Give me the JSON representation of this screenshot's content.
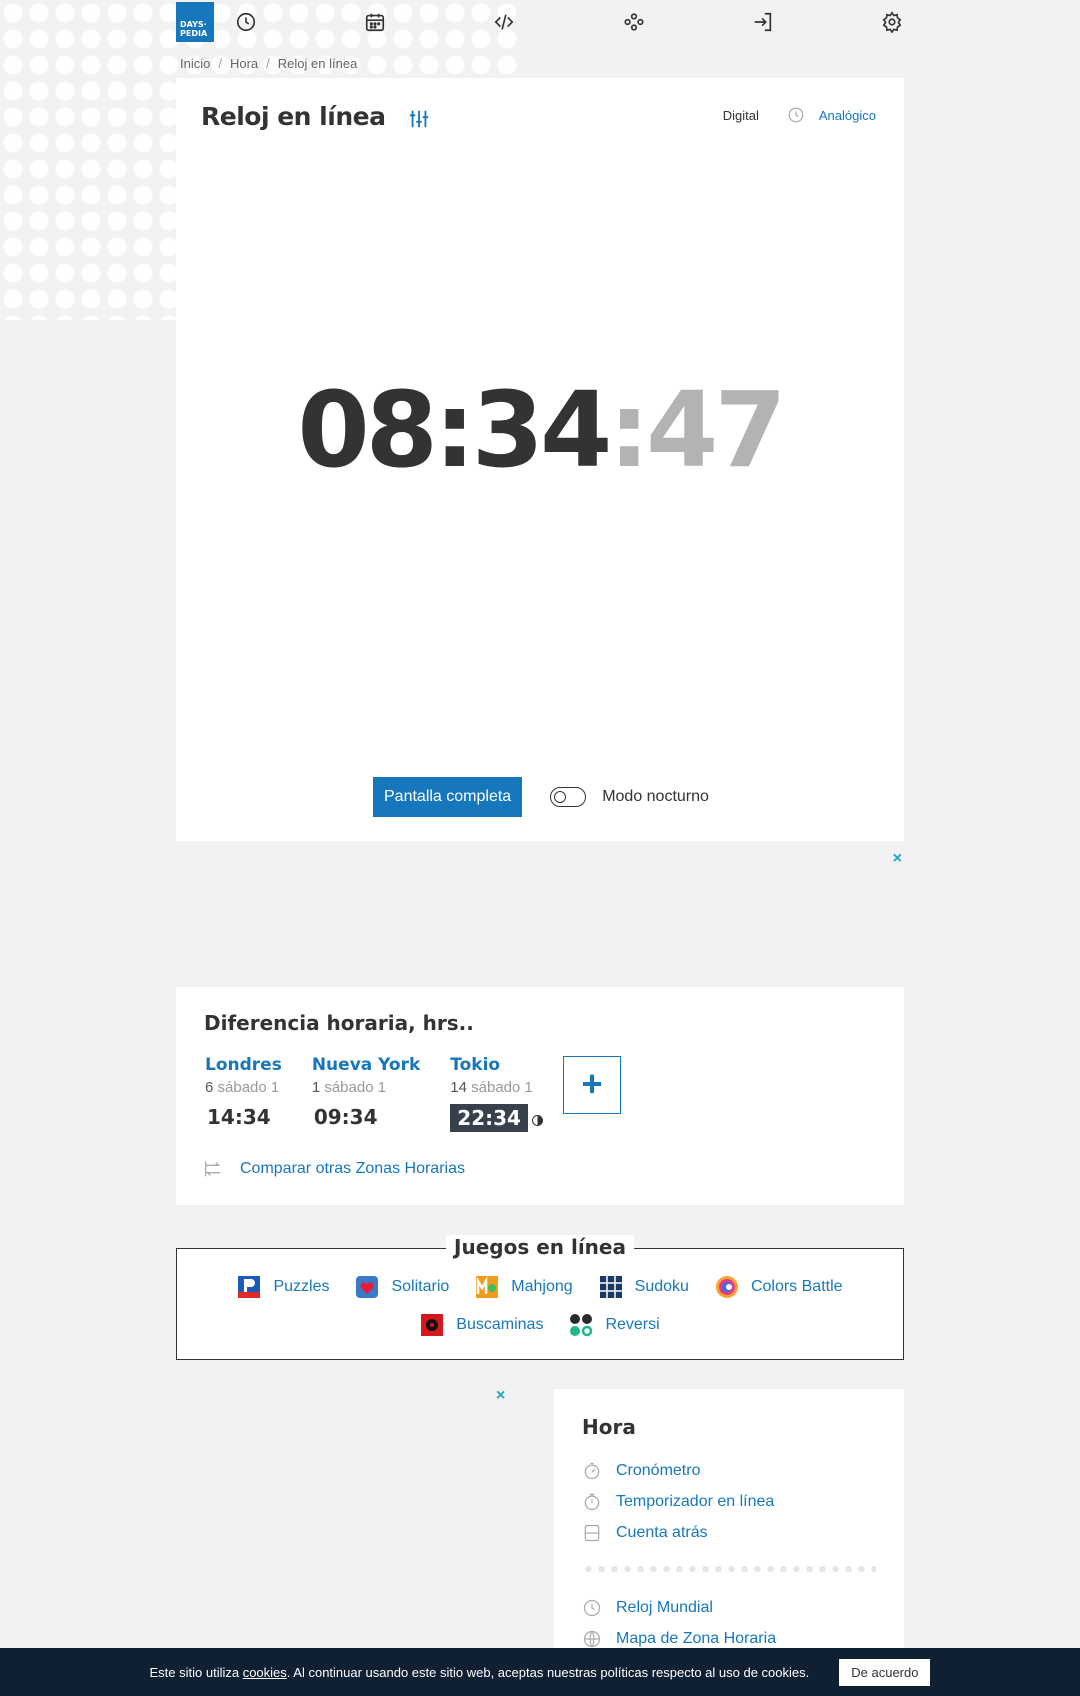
{
  "logo": {
    "line1": "DAYS·",
    "line2": "PEDIA"
  },
  "breadcrumb": [
    "Inicio",
    "Hora",
    "Reloj en línea"
  ],
  "clock_card": {
    "title": "Reloj en línea",
    "mode_digital": "Digital",
    "mode_analog": "Analógico",
    "time_hm": "08:34",
    "time_sec": ":47",
    "fullscreen_button": "Pantalla completa",
    "night_mode_label": "Modo nocturno"
  },
  "time_diff": {
    "title": "Diferencia horaria, hrs..",
    "cities": [
      {
        "name": "Londres",
        "offset": "6",
        "day": "sábado 1",
        "time": "14:34"
      },
      {
        "name": "Nueva York",
        "offset": "1",
        "day": "sábado 1",
        "time": "09:34"
      },
      {
        "name": "Tokio",
        "offset": "14",
        "day": "sábado 1",
        "time": "22:34"
      }
    ],
    "add_label": "+",
    "compare_link": "Comparar otras Zonas Horarias"
  },
  "games": {
    "title": "Juegos en línea",
    "items": [
      "Puzzles",
      "Solitario",
      "Mahjong",
      "Sudoku",
      "Colors Battle",
      "Buscaminas",
      "Reversi"
    ]
  },
  "ad_close": "×",
  "side": {
    "title": "Hora",
    "items": [
      "Cronómetro",
      "Temporizador en línea",
      "Cuenta atrás"
    ],
    "items2": [
      "Reloj Mundial",
      "Mapa de Zona Horaria"
    ]
  },
  "cookie": {
    "text_before": "Este sitio utiliza ",
    "link": "cookies",
    "text_after": ". Al continuar usando este sitio web, aceptas nuestras políticas respecto al uso de cookies.",
    "button": "De acuerdo"
  },
  "colors": {
    "accent": "#1777bd",
    "night_badge": "#37404b",
    "cookie_bar": "#0f2033"
  },
  "icons": [
    "clock-icon",
    "calendar-icon",
    "code-icon",
    "games-icon",
    "login-icon",
    "settings-gear-icon"
  ]
}
